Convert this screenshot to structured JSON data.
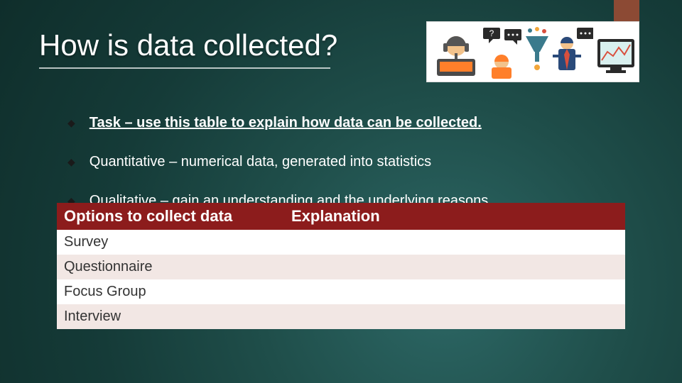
{
  "title": "How is data collected?",
  "bullets": {
    "task": "Task – use this table to explain how data can be collected.",
    "quant": "Quantitative – numerical data, generated into statistics",
    "qual": "Qualitative – gain an understanding and the underlying reasons"
  },
  "table": {
    "header": {
      "options": "Options to collect data",
      "explanation": "Explanation"
    },
    "rows": [
      {
        "option": "Survey",
        "explanation": ""
      },
      {
        "option": "Questionnaire",
        "explanation": ""
      },
      {
        "option": "Focus Group",
        "explanation": ""
      },
      {
        "option": "Interview",
        "explanation": ""
      }
    ]
  }
}
